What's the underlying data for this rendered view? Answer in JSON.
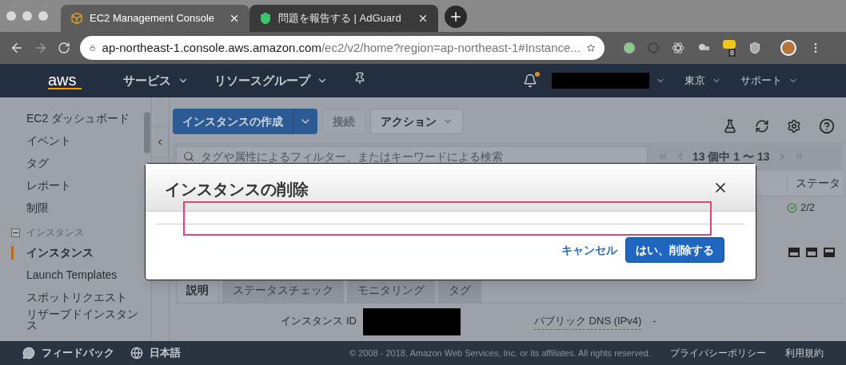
{
  "browser": {
    "tabs": [
      {
        "title": "EC2 Management Console",
        "selected": true,
        "kind": "aws"
      },
      {
        "title": "問題を報告する | AdGuard",
        "selected": false,
        "kind": "shield"
      }
    ],
    "address": {
      "host": "ap-northeast-1.console.aws.amazon.com",
      "path": "/ec2/v2/home?region=ap-northeast-1#Instance..."
    },
    "extension_badge": "8"
  },
  "aws_nav": {
    "logo": "aws",
    "menus": [
      "サービス",
      "リソースグループ"
    ],
    "has_notification": true,
    "region": "東京",
    "support": "サポート"
  },
  "sidebar": {
    "items": [
      {
        "label": "EC2 ダッシュボード",
        "selected": false
      },
      {
        "label": "イベント",
        "selected": false
      },
      {
        "label": "タグ",
        "selected": false
      },
      {
        "label": "レポート",
        "selected": false
      },
      {
        "label": "制限",
        "selected": false
      },
      {
        "label": "インスタンス",
        "expanded": true,
        "children": [
          {
            "label": "インスタンス",
            "selected": true
          },
          {
            "label": "Launch Templates",
            "selected": false
          },
          {
            "label": "スポットリクエスト",
            "selected": false
          },
          {
            "label": "リザーブドインスタンス",
            "selected": false
          }
        ]
      }
    ]
  },
  "toolbar": {
    "create": "インスタンスの作成",
    "connect": {
      "label": "接続",
      "disabled": true
    },
    "actions": "アクション"
  },
  "search": {
    "placeholder": "タグや属性によるフィルター、またはキーワードによる検索"
  },
  "pagination": "13 個中 1 〜 13",
  "table": {
    "columns": [
      "ステータ"
    ],
    "rows": [
      {
        "status": "2/2"
      }
    ]
  },
  "detail_tabs": [
    {
      "label": "説明",
      "selected": true
    },
    {
      "label": "ステータスチェック",
      "selected": false
    },
    {
      "label": "モニタリング",
      "selected": false
    },
    {
      "label": "タグ",
      "selected": false
    }
  ],
  "details": [
    {
      "label": "インスタンス ID"
    },
    {
      "label": "パブリック DNS (IPv4)",
      "value": "-"
    }
  ],
  "modal": {
    "title": "インスタンスの削除",
    "cancel": "キャンセル",
    "confirm": "はい、削除する"
  },
  "footer": {
    "feedback": "フィードバック",
    "language": "日本語",
    "copyright": "© 2008 - 2018, Amazon Web Services, Inc. or its affiliates. All rights reserved.",
    "privacy": "プライバシーポリシー",
    "terms": "利用規約"
  }
}
